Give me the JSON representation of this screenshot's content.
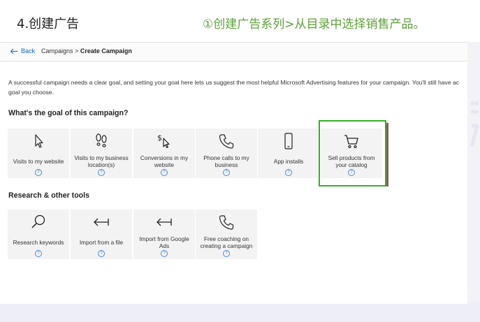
{
  "slide": {
    "title": "4.创建广告",
    "note": "①创建广告系列>从目录中选择销售产品。"
  },
  "topbar": {
    "back_label": "Back",
    "breadcrumb_parent": "Campaigns",
    "breadcrumb_sep": ">",
    "breadcrumb_current": "Create Campaign"
  },
  "description": "A successful campaign needs a clear goal, and setting your goal here lets us suggest the most helpful Microsoft Advertising features for your campaign. You'll still have ac goal you choose.",
  "goals": {
    "heading": "What's the goal of this campaign?",
    "items": [
      {
        "label": "Visits to my website",
        "icon": "cursor-icon"
      },
      {
        "label": "Visits to my business location(s)",
        "icon": "footprints-icon"
      },
      {
        "label": "Conversions in my website",
        "icon": "dollar-cursor-icon"
      },
      {
        "label": "Phone calls to my business",
        "icon": "phone-icon"
      },
      {
        "label": "App installs",
        "icon": "mobile-icon"
      },
      {
        "label": "Sell products from your catalog",
        "icon": "cart-icon"
      }
    ]
  },
  "tools": {
    "heading": "Research & other tools",
    "items": [
      {
        "label": "Research keywords",
        "icon": "search-icon"
      },
      {
        "label": "Import from a file",
        "icon": "import-arrow-icon"
      },
      {
        "label": "Import from Google Ads",
        "icon": "import-arrow-icon"
      },
      {
        "label": "Free coaching on creating a campaign",
        "icon": "phone-icon"
      }
    ]
  },
  "help_glyph": "?",
  "colors": {
    "highlight": "#35b025",
    "note_text": "#5da03a",
    "link": "#0b64c4"
  }
}
